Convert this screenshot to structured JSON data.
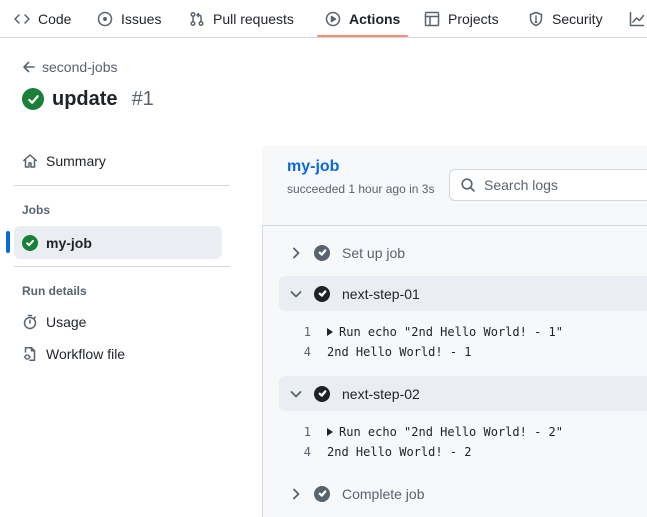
{
  "tabs": [
    {
      "label": "Code",
      "icon": "code-icon"
    },
    {
      "label": "Issues",
      "icon": "issue-opened-icon"
    },
    {
      "label": "Pull requests",
      "icon": "git-pull-request-icon"
    },
    {
      "label": "Actions",
      "icon": "play-icon",
      "active": true
    },
    {
      "label": "Projects",
      "icon": "table-icon"
    },
    {
      "label": "Security",
      "icon": "shield-icon"
    },
    {
      "label": "",
      "icon": "graph-icon"
    }
  ],
  "header": {
    "back_label": "second-jobs",
    "title": "update",
    "run_number": "#1"
  },
  "sidebar": {
    "summary": "Summary",
    "jobs_heading": "Jobs",
    "jobs": [
      {
        "label": "my-job",
        "status": "success"
      }
    ],
    "run_details_heading": "Run details",
    "details": [
      {
        "label": "Usage",
        "icon": "stopwatch-icon"
      },
      {
        "label": "Workflow file",
        "icon": "file-code-icon"
      }
    ]
  },
  "job": {
    "name": "my-job",
    "status_text": "succeeded 1 hour ago in 3s",
    "search_placeholder": "Search logs"
  },
  "steps": [
    {
      "label": "Set up job",
      "expanded": false
    },
    {
      "label": "next-step-01",
      "expanded": true,
      "lines": [
        {
          "num": "1",
          "text": "Run echo \"2nd Hello World! - 1\"",
          "group": true
        },
        {
          "num": "4",
          "text": "2nd Hello World! - 1",
          "group": false
        }
      ]
    },
    {
      "label": "next-step-02",
      "expanded": true,
      "lines": [
        {
          "num": "1",
          "text": "Run echo \"2nd Hello World! - 2\"",
          "group": true
        },
        {
          "num": "4",
          "text": "2nd Hello World! - 2",
          "group": false
        }
      ]
    },
    {
      "label": "Complete job",
      "expanded": false
    }
  ],
  "colors": {
    "accent_link": "#0969da",
    "success": "#1a7f37",
    "active_tab_underline": "#fd8c73"
  }
}
